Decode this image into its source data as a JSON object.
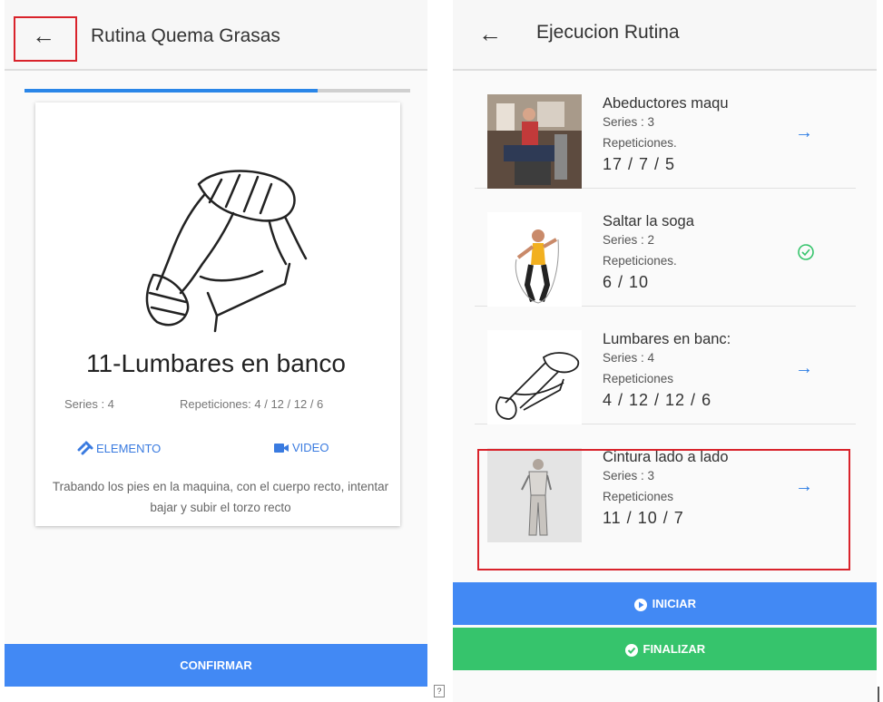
{
  "left_screen": {
    "title": "Rutina Quema Grasas",
    "progress": 0.76,
    "exercise": {
      "name": "11-Lumbares en banco",
      "series_text": "Series : 4",
      "reps_text": "Repeticiones: 4 / 12 / 12 / 6",
      "element_link": "ELEMENTO",
      "video_link": "VIDEO",
      "description": "Trabando los pies en la maquina, con el cuerpo recto, intentar bajar y subir el torzo recto"
    },
    "confirm_label": "CONFIRMAR"
  },
  "right_screen": {
    "title": "Ejecucion Rutina",
    "exercises": [
      {
        "name": "Abeductores maqu",
        "series": "Series : 3",
        "reps_label": "Repeticiones.",
        "reps": "17 / 7 / 5",
        "status": "arrow-right-icon"
      },
      {
        "name": "Saltar la soga",
        "series": "Series : 2",
        "reps_label": "Repeticiones.",
        "reps": "6 / 10",
        "status": "check-circle-icon"
      },
      {
        "name": "Lumbares en banc:",
        "series": "Series : 4",
        "reps_label": "Repeticiones",
        "reps": "4 / 12 / 12 / 6",
        "status": "arrow-right-icon"
      },
      {
        "name": "Cintura lado a lado",
        "series": "Series : 3",
        "reps_label": "Repeticiones",
        "reps": "11 / 10 / 7",
        "status": "arrow-right-icon"
      }
    ],
    "start_label": "INICIAR",
    "finish_label": "FINALIZAR"
  },
  "colors": {
    "primary": "#4289f4",
    "success": "#36c46c",
    "highlight": "#d9232b",
    "progress": "#2a86e8"
  }
}
